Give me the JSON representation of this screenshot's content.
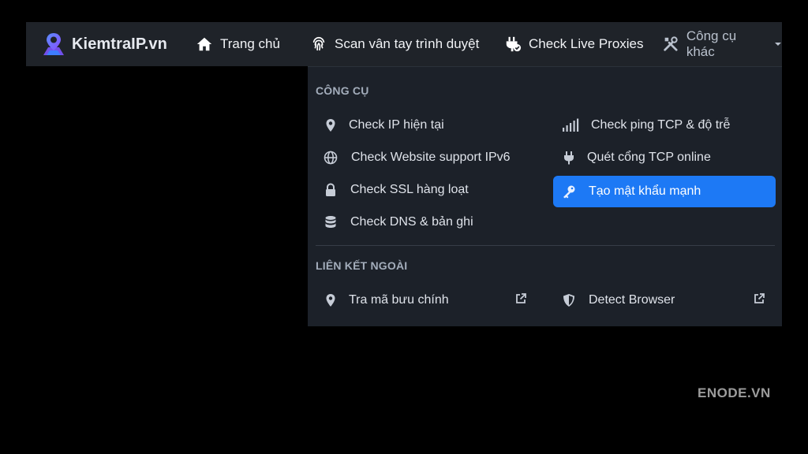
{
  "brand": {
    "name": "KiemtraIP.vn"
  },
  "nav": {
    "home": "Trang chủ",
    "fingerprint": "Scan vân tay trình duyệt",
    "proxies": "Check Live Proxies",
    "more_tools": "Công cụ khác"
  },
  "dropdown": {
    "tools_title": "CÔNG CỤ",
    "tools_left": [
      {
        "label": "Check IP hiện tại",
        "icon": "map-pin-icon"
      },
      {
        "label": "Check Website support IPv6",
        "icon": "globe-icon"
      },
      {
        "label": "Check SSL hàng loạt",
        "icon": "lock-icon"
      },
      {
        "label": "Check DNS & bản ghi",
        "icon": "database-icon"
      }
    ],
    "tools_right": [
      {
        "label": "Check ping TCP & độ trễ",
        "icon": "signal-bars-icon"
      },
      {
        "label": "Quét cổng TCP online",
        "icon": "plug-icon"
      },
      {
        "label": "Tạo mật khẩu mạnh",
        "icon": "key-icon",
        "active": true
      }
    ],
    "links_title": "LIÊN KẾT NGOÀI",
    "links": [
      {
        "label": "Tra mã bưu chính",
        "icon": "map-pin-icon"
      },
      {
        "label": "Detect Browser",
        "icon": "shield-icon"
      }
    ]
  },
  "watermark": "ENODE.VN",
  "colors": {
    "navbar_bg": "#1f2329",
    "dropdown_bg": "#1c2129",
    "active_bg": "#1d79f5",
    "page_bg": "#000000"
  }
}
